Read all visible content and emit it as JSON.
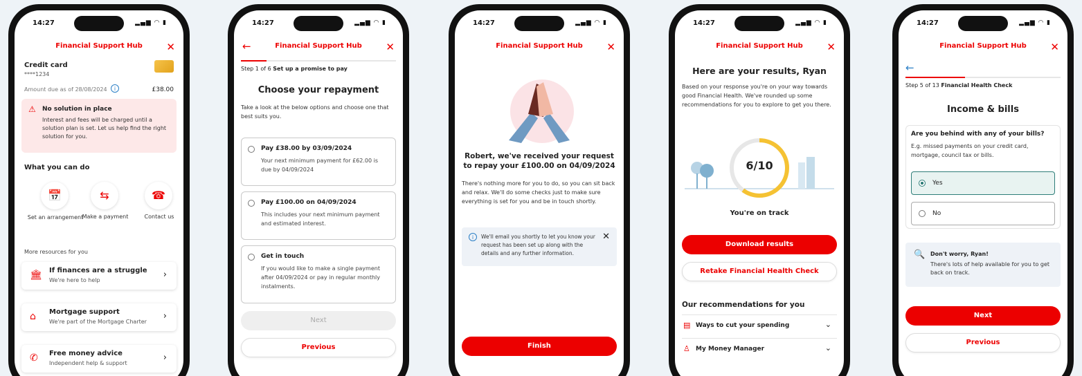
{
  "status_time": "14:27",
  "status_icons": "▂▄▆ ◠ ▮",
  "app_title": "Financial Support Hub",
  "screen1": {
    "card_title": "Credit card",
    "card_number": "****1234",
    "amount_label": "Amount due as of 28/08/2024",
    "amount_value": "£38.00",
    "alert_title": "No solution in place",
    "alert_text": "Interest and fees will be charged until a solution plan is set. Let us help find the right solution for you.",
    "section_title": "What you can do",
    "actions": [
      {
        "label": "Set an arrangement",
        "icon": "calendar-icon"
      },
      {
        "label": "Make a payment",
        "icon": "payment-icon"
      },
      {
        "label": "Contact us",
        "icon": "headset-icon"
      }
    ],
    "resources_title": "More resources for you",
    "resources": [
      {
        "title": "If finances are a struggle",
        "subtitle": "We're here to help",
        "icon": "bank-icon"
      },
      {
        "title": "Mortgage support",
        "subtitle": "We're part of the Mortgage Charter",
        "icon": "house-icon"
      },
      {
        "title": "Free money advice",
        "subtitle": "Independent help & support",
        "icon": "advice-icon"
      }
    ]
  },
  "screen2": {
    "step_prefix": "Step 1 of 6",
    "step_name": "Set up a promise to pay",
    "title": "Choose your repayment",
    "intro": "Take a look at the below options and choose one that best suits you.",
    "options": [
      {
        "title": "Pay £38.00 by 03/09/2024",
        "text": "Your next minimum payment for £62.00 is due by 04/09/2024"
      },
      {
        "title": "Pay £100.00 on 04/09/2024",
        "text": "This includes your next minimum payment and estimated interest."
      },
      {
        "title": "Get in touch",
        "text": "If you would like to make a single payment after 04/09/2024 or pay in regular monthly instalments."
      }
    ],
    "next_label": "Next",
    "previous_label": "Previous"
  },
  "screen3": {
    "heading": "Robert, we've received your request to repay your £100.00 on 04/09/2024",
    "body": "There's nothing more for you to do, so you can sit back and relax. We'll do some checks just to make sure everything is set for you and be in touch shortly.",
    "info": "We'll email you shortly to let you know your request has been set up along with the details and any further information.",
    "finish_label": "Finish"
  },
  "screen4": {
    "title": "Here are your results, Ryan",
    "body": "Based on your response you're on your way towards good Financial Health. We've rounded up some recommendations for you to explore to get you there.",
    "score": "6/10",
    "score_fraction": 0.6,
    "status": "You're on track",
    "download_label": "Download results",
    "retake_label": "Retake Financial Health Check",
    "rec_title": "Our recommendations for you",
    "recommendations": [
      {
        "label": "Ways to cut your spending",
        "icon": "receipt-icon"
      },
      {
        "label": "My Money Manager",
        "icon": "money-icon"
      }
    ]
  },
  "screen5": {
    "step_prefix": "Step 5 of 13",
    "step_name": "Financial Health Check",
    "title": "Income & bills",
    "question": "Are you behind with any of your bills?",
    "hint": "E.g. missed payments on your credit card, mortgage, council tax or bills.",
    "options": [
      "Yes",
      "No"
    ],
    "tip_title": "Don't worry, Ryan!",
    "tip_text": "There's lots of help available for you to get back on track.",
    "next_label": "Next",
    "previous_label": "Previous"
  },
  "colors": {
    "brand_red": "#ec0000",
    "alert_bg": "#fde8e8",
    "info_bg": "#eef2f7",
    "score_ring": "#f5c233",
    "selected_bg": "#e8f3f1",
    "selected_border": "#2d7d78"
  }
}
